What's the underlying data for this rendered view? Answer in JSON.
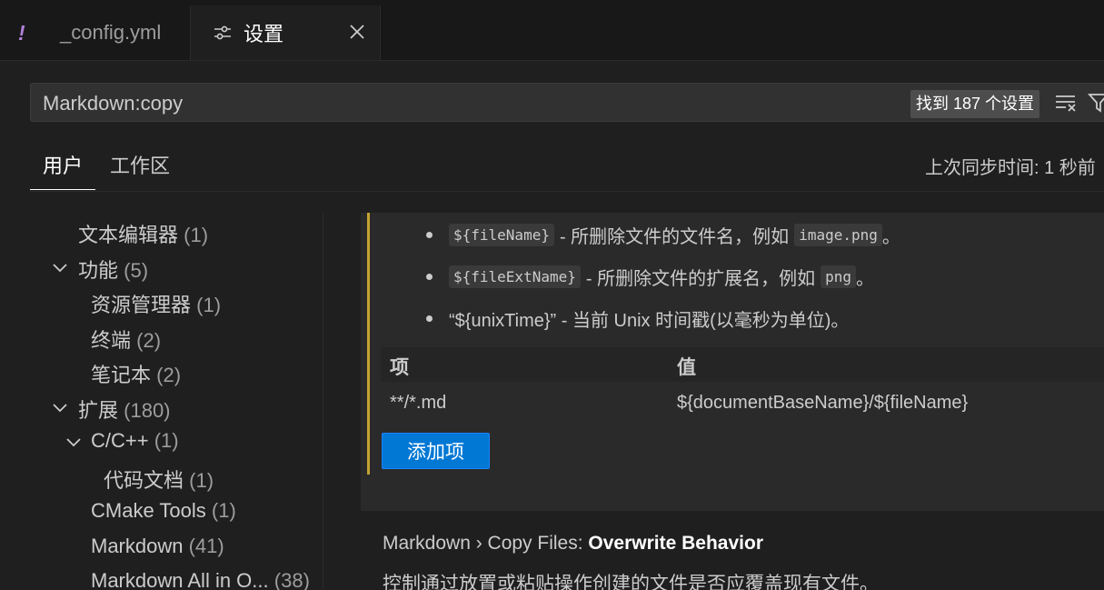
{
  "tabs": [
    {
      "label": "_config.yml",
      "icon": "yaml-exclamation-icon"
    },
    {
      "label": "设置",
      "icon": "settings-sliders-icon",
      "close_icon": "close-icon"
    }
  ],
  "search": {
    "value": "Markdown:copy",
    "found_badge": "找到 187 个设置"
  },
  "scope_tabs": {
    "user": "用户",
    "workspace": "工作区",
    "sync_status": "上次同步时间: 1 秒前"
  },
  "toc": [
    {
      "label": "文本编辑器",
      "count": "(1)"
    },
    {
      "label": "功能",
      "count": "(5)"
    },
    {
      "label": "资源管理器",
      "count": "(1)"
    },
    {
      "label": "终端",
      "count": "(2)"
    },
    {
      "label": "笔记本",
      "count": "(2)"
    },
    {
      "label": "扩展",
      "count": "(180)"
    },
    {
      "label": "C/C++",
      "count": "(1)"
    },
    {
      "label": "代码文档",
      "count": "(1)"
    },
    {
      "label": "CMake Tools",
      "count": "(1)"
    },
    {
      "label": "Markdown",
      "count": "(41)"
    },
    {
      "label": "Markdown All in O...",
      "count": "(38)"
    }
  ],
  "setting": {
    "bullets": [
      {
        "code": "${fileName}",
        "text": "- 所删除文件的文件名，例如",
        "example": "image.png",
        "end": "。"
      },
      {
        "code": "${fileExtName}",
        "text": "- 所删除文件的扩展名，例如",
        "example": "png",
        "end": "。"
      },
      {
        "text": "“${unixTime}” - 当前 Unix 时间戳(以毫秒为单位)。"
      }
    ],
    "table": {
      "key_header": "项",
      "value_header": "值",
      "rows": [
        {
          "key": "**/*.md",
          "value": "${documentBaseName}/${fileName}"
        }
      ]
    },
    "add_button": "添加项"
  },
  "next_setting": {
    "category": "Markdown › Copy Files: ",
    "name": "Overwrite Behavior",
    "description": "控制通过放置或粘贴操作创建的文件是否应覆盖现有文件。"
  },
  "colors": {
    "accent": "#0078d4",
    "modified_bar": "#c5a332",
    "yaml_icon": "#b180d7"
  }
}
